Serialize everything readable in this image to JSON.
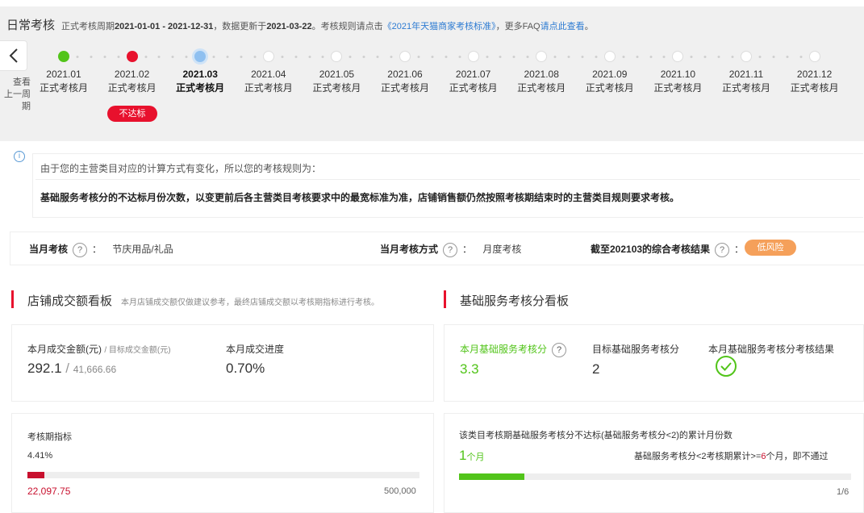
{
  "header": {
    "title": "日常考核",
    "period_prefix": "正式考核周期",
    "period": "2021-01-01 - 2021-12-31",
    "update_prefix": "，数据更新于",
    "update_date": "2021-03-22",
    "rule_prefix": "。考核规则请点击",
    "rule_link": "《2021年天猫商家考核标准》",
    "faq_prefix": "，更多FAQ",
    "faq_link": "请点此查看",
    "end": "。"
  },
  "back": {
    "label_line1": "查看",
    "label_line2": "上一周期"
  },
  "timeline": {
    "months": [
      {
        "date": "2021.01",
        "sub": "正式考核月",
        "status": "green"
      },
      {
        "date": "2021.02",
        "sub": "正式考核月",
        "status": "red"
      },
      {
        "date": "2021.03",
        "sub": "正式考核月",
        "status": "current"
      },
      {
        "date": "2021.04",
        "sub": "正式考核月",
        "status": "empty"
      },
      {
        "date": "2021.05",
        "sub": "正式考核月",
        "status": "empty"
      },
      {
        "date": "2021.06",
        "sub": "正式考核月",
        "status": "empty"
      },
      {
        "date": "2021.07",
        "sub": "正式考核月",
        "status": "empty"
      },
      {
        "date": "2021.08",
        "sub": "正式考核月",
        "status": "empty"
      },
      {
        "date": "2021.09",
        "sub": "正式考核月",
        "status": "empty"
      },
      {
        "date": "2021.10",
        "sub": "正式考核月",
        "status": "empty"
      },
      {
        "date": "2021.11",
        "sub": "正式考核月",
        "status": "empty"
      },
      {
        "date": "2021.12",
        "sub": "正式考核月",
        "status": "empty"
      }
    ],
    "fail_badge": "不达标"
  },
  "notice": {
    "line1": "由于您的主营类目对应的计算方式有变化，所以您的考核规则为：",
    "line2": "基础服务考核分的不达标月份次数，以变更前后各主营类目考核要求中的最宽标准为准，店铺销售额仍然按照考核期结束时的主营类目规则要求考核。"
  },
  "status": {
    "category_label": "当月考核",
    "category_value": "节庆用品/礼品",
    "method_label": "当月考核方式",
    "method_value": "月度考核",
    "result_label": "截至202103的综合考核结果",
    "result_value": "低风险",
    "colon": "："
  },
  "sales_board": {
    "title": "店铺成交额看板",
    "subtitle": "本月店铺成交额仅做建议参考，最终店铺成交额以考核期指标进行考核。",
    "amount_label": "本月成交金额(元)",
    "target_label": "/ 目标成交金额(元)",
    "amount_value": "292.1",
    "target_value": "41,666.66",
    "slash": "/",
    "progress_label": "本月成交进度",
    "progress_value": "0.70%",
    "period_label": "考核期指标",
    "period_percent": "4.41%",
    "period_progress": 0.0441,
    "period_current": "22,097.75",
    "period_target": "500,000"
  },
  "service_board": {
    "title": "基础服务考核分看板",
    "score_label": "本月基础服务考核分",
    "score_value": "3.3",
    "target_label": "目标基础服务考核分",
    "target_value": "2",
    "result_label": "本月基础服务考核分考核结果",
    "fail_months_label": "该类目考核期基础服务考核分不达标(基础服务考核分<2)的累计月份数",
    "fail_months_value": "1",
    "fail_months_unit": "个月",
    "rule_prefix": "基础服务考核分<2考核期累计>=",
    "rule_num": "6",
    "rule_suffix": "个月，即不通过",
    "fail_progress": 0.1667,
    "page": "1/6"
  },
  "colors": {
    "red": "#e8112d",
    "green": "#52c41a",
    "orange": "#f5a05a",
    "blue": "#2d7bd2"
  },
  "icons": [
    "chevron-left-icon",
    "info-icon",
    "question-icon",
    "check-circle-icon"
  ]
}
